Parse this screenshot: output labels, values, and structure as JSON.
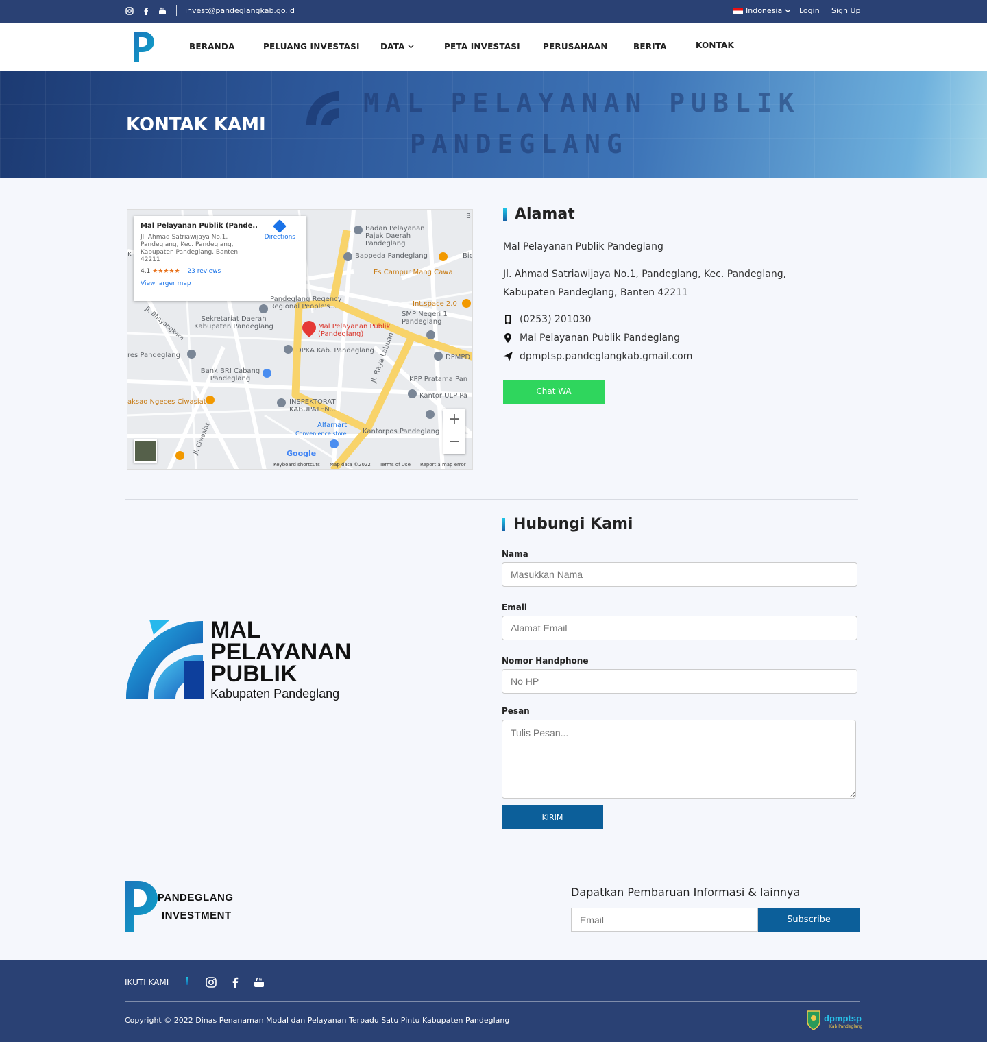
{
  "topbar": {
    "email": "invest@pandeglangkab.go.id",
    "language": "Indonesia",
    "login": "Login",
    "signup": "Sign Up",
    "social_icons": [
      "instagram-icon",
      "facebook-icon",
      "youtube-icon"
    ]
  },
  "nav": {
    "items": [
      "BERANDA",
      "PELUANG INVESTASI",
      "DATA",
      "PETA INVESTASI",
      "PERUSAHAAN",
      "BERITA",
      "KONTAK"
    ]
  },
  "hero": {
    "title": "KONTAK KAMI",
    "sign_line1": "MAL PELAYANAN PUBLIK",
    "sign_line2": "PANDEGLANG"
  },
  "map": {
    "card_title": "Mal Pelayanan Publik (Pande...",
    "card_address": "Jl. Ahmad Satriawijaya No.1, Pandeglang, Kec. Pandeglang, Kabupaten Pandeglang, Banten 42211",
    "rating": "4.1",
    "stars": "★★★★★",
    "reviews": "23 reviews",
    "larger_map": "View larger map",
    "directions": "Directions",
    "pin_label": "Mal Pelayanan Publik (Pandeglang)",
    "places": {
      "badan": "Badan Pelayanan Pajak Daerah Pandeglang",
      "bappeda": "Bappeda Pandeglang",
      "es": "Es Campur Mang Cawa",
      "intspace": "Int.space 2.0",
      "smp": "SMP Negeri 1 Pandeglang",
      "regency": "Pandeglang Regency Regional People's...",
      "sekretariat": "Sekretariat Daerah Kabupaten Pandeglang",
      "dpka": "DPKA Kab. Pandeglang",
      "dpmpd": "DPMPD",
      "res": "res Pandeglang",
      "bri": "Bank BRI Cabang Pandeglang",
      "kpp": "KPP Pratama Pan",
      "kantor_ulp": "Kantor ULP Pa",
      "aksao": "aksao Ngeces Ciwasiat",
      "inspektorat": "INSPEKTORAT KABUPATEN...",
      "alfamart": "Alfamart",
      "convenience": "Convenience store",
      "kantorpos": "Kantorpos Pandeglang",
      "jl_raya": "Jl. Raya Labuan",
      "jl_bhay": "Jl. Bhayangkara",
      "jl_ciw": "Jl. Ciwasiat",
      "b": "B",
      "bic": "Bic",
      "k": "K"
    },
    "google": "Google",
    "footer_items": [
      "Keyboard shortcuts",
      "Map data ©2022",
      "Terms of Use",
      "Report a map error"
    ],
    "zoom_in": "+",
    "zoom_out": "−"
  },
  "address": {
    "heading": "Alamat",
    "name": "Mal Pelayanan Publik Pandeglang",
    "street": "Jl. Ahmad Satriawijaya No.1, Pandeglang, Kec. Pandeglang, Kabupaten Pandeglang, Banten 42211",
    "phone": "(0253) 201030",
    "location": "Mal Pelayanan Publik Pandeglang",
    "email": "dpmptsp.pandeglangkab.gmail.com",
    "wa_button": "Chat WA"
  },
  "mpp_logo": {
    "line1": "MAL",
    "line2": "PELAYANAN",
    "line3": "PUBLIK",
    "line4": "Kabupaten Pandeglang"
  },
  "form": {
    "heading": "Hubungi Kami",
    "name_label": "Nama",
    "name_placeholder": "Masukkan Nama",
    "email_label": "Email",
    "email_placeholder": "Alamat Email",
    "phone_label": "Nomor Handphone",
    "phone_placeholder": "No HP",
    "message_label": "Pesan",
    "message_placeholder": "Tulis Pesan...",
    "submit": "KIRIM"
  },
  "footer": {
    "logo_line1": "PANDEGLANG",
    "logo_line2": "INVESTMENT",
    "newsletter_title": "Dapatkan Pembaruan Informasi & lainnya",
    "newsletter_placeholder": "Email",
    "subscribe": "Subscribe",
    "follow": "IKUTI KAMI",
    "copyright": "Copyright © 2022 Dinas Penanaman Modal dan Pelayanan Terpadu Satu Pintu Kabupaten Pandeglang",
    "dpmptsp_logo": "dpmptsp",
    "dpmptsp_sub": "Kab.Pandeglang"
  },
  "colors": {
    "primary_dark": "#2a4174",
    "button_blue": "#0c5f9a",
    "whatsapp_green": "#2fd65d",
    "accent_cyan": "#1ec4e6"
  }
}
